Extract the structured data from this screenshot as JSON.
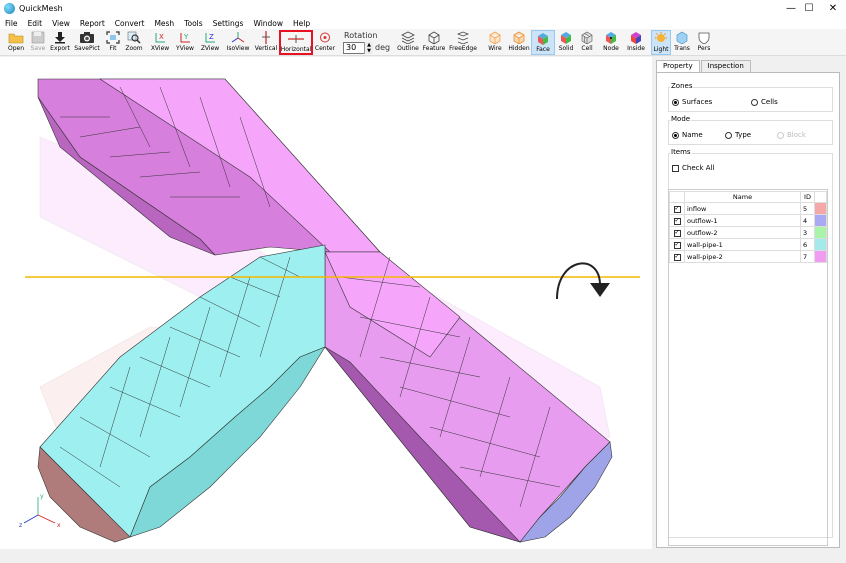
{
  "window": {
    "title": "QuickMesh",
    "controls": {
      "minimize": "—",
      "maximize": "☐",
      "close": "✕"
    }
  },
  "menu": [
    "File",
    "Edit",
    "View",
    "Report",
    "Convert",
    "Mesh",
    "Tools",
    "Settings",
    "Window",
    "Help"
  ],
  "toolbar": {
    "open": "Open",
    "save": "Save",
    "export": "Export",
    "savepict": "SavePict",
    "fit": "Fit",
    "zoom": "Zoom",
    "xview": "XView",
    "yview": "YView",
    "zview": "ZView",
    "isoview": "IsoView",
    "vertical": "Vertical",
    "horizontal": "Horizontal",
    "center": "Center",
    "rotation_label": "Rotation",
    "rotation_value": "30",
    "rotation_unit": "deg",
    "outline": "Outline",
    "feature": "Feature",
    "freeedge": "FreeEdge",
    "wire": "Wire",
    "hidden": "Hidden",
    "face": "Face",
    "solid": "Solid",
    "cell": "Cell",
    "node": "Node",
    "inside": "Inside",
    "light": "Light",
    "trans": "Trans",
    "pers": "Pers"
  },
  "axes": {
    "x": "x",
    "y": "y",
    "z": "z"
  },
  "panel": {
    "tabs": [
      "Property",
      "Inspection"
    ],
    "zones": {
      "title": "Zones",
      "surfaces": "Surfaces",
      "cells": "Cells",
      "selected": "surfaces"
    },
    "mode": {
      "title": "Mode",
      "name": "Name",
      "type": "Type",
      "block": "Block",
      "selected": "name"
    },
    "items": {
      "title": "Items",
      "check_all": "Check All",
      "col_name": "Name",
      "col_id": "ID",
      "rows": [
        {
          "name": "inflow",
          "id": "5",
          "color": "#f4a9a8",
          "checked": true
        },
        {
          "name": "outflow-1",
          "id": "4",
          "color": "#a9a9f4",
          "checked": true
        },
        {
          "name": "outflow-2",
          "id": "3",
          "color": "#a9f4a9",
          "checked": true
        },
        {
          "name": "wall-pipe-1",
          "id": "6",
          "color": "#a4eaea",
          "checked": true
        },
        {
          "name": "wall-pipe-2",
          "id": "7",
          "color": "#f09cf0",
          "checked": true
        }
      ]
    }
  },
  "colors": {
    "pipe1": "#9ef0f0",
    "pipe2": "#f09cf8",
    "section_line": "#f2b800",
    "highlight": "#e81123"
  }
}
